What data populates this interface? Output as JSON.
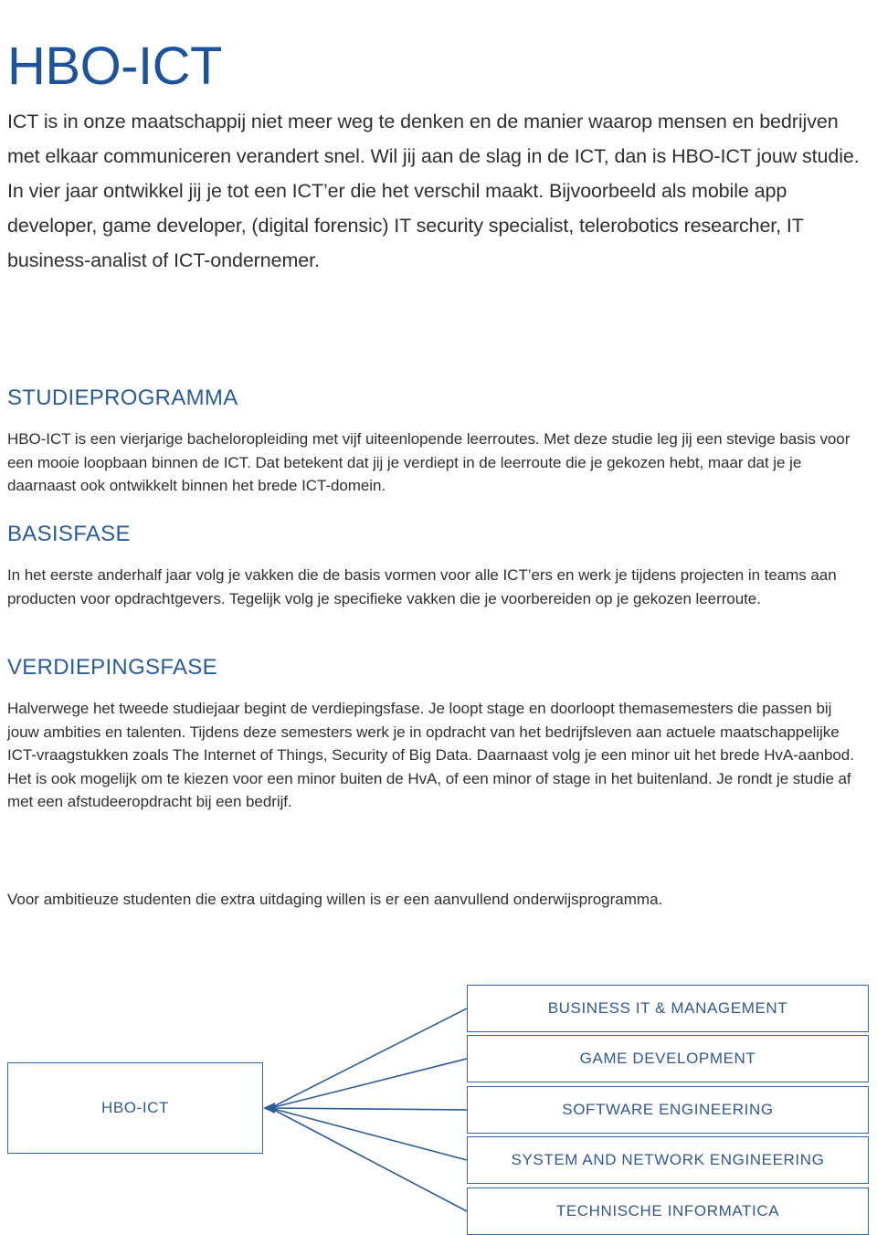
{
  "document": {
    "title": "HBO-ICT",
    "intro": "ICT is in onze maatschappij niet meer weg te denken en de manier waarop mensen en bedrijven met elkaar communiceren verandert snel. Wil jij aan de slag in de ICT, dan is HBO-ICT jouw studie. In vier jaar ontwikkel jij je tot een ICT’er die het verschil maakt. Bijvoorbeeld als mobile app developer, game developer, (digital forensic) IT security specialist, telerobotics researcher, IT business-analist of ICT-ondernemer.",
    "closing_note": "Voor ambitieuze studenten die extra uitdaging willen is er een aanvullend onderwijsprogramma."
  },
  "sections": [
    {
      "heading": "STUDIEPROGRAMMA",
      "body": "HBO-ICT is een vierjarige bacheloropleiding met vijf uiteenlopende leerroutes. Met deze studie leg jij een stevige basis voor een mooie loopbaan binnen de ICT. Dat betekent dat jij je verdiept in de leerroute die je gekozen hebt, maar dat je je daarnaast ook ontwikkelt binnen het brede ICT-domein."
    },
    {
      "heading": "BASISFASE",
      "body": "In het eerste anderhalf jaar volg je vakken die  de basis vormen voor alle ICT’ers en werk je tijdens projecten in teams aan producten voor opdrachtgevers. Tegelijk volg je specifieke vakken die je voorbereiden op je gekozen leerroute."
    },
    {
      "heading": "VERDIEPINGSFASE",
      "body": "Halverwege het tweede studiejaar begint de verdiepingsfase. Je loopt stage en doorloopt themasemesters die passen bij jouw ambities  en talenten. Tijdens deze semesters werk je in opdracht van het bedrijfsleven aan actuele maatschappelijke ICT-vraagstukken zoals The Internet of Things, Security of Big Data. Daarnaast volg je een minor uit het brede HvA-aanbod. Het is ook mogelijk om te kiezen voor een minor buiten de HvA, of een minor of stage in het buitenland. Je rondt je studie af met een afstudeeropdracht bij een bedrijf."
    }
  ],
  "diagram": {
    "root_label": "HBO-ICT",
    "leaves": [
      {
        "label": "BUSINESS IT & MANAGEMENT"
      },
      {
        "label": "GAME DEVELOPMENT"
      },
      {
        "label": "SOFTWARE ENGINEERING"
      },
      {
        "label": "SYSTEM AND NETWORK ENGINEERING"
      },
      {
        "label": "TECHNISCHE INFORMATICA"
      }
    ],
    "line_color": "#2f5c94",
    "box_border_color": "#36659e",
    "box_text_color": "#33598a"
  },
  "colors": {
    "title_blue": "#1f5399",
    "heading_blue": "#2a5c96",
    "body_text": "#2f2f2f"
  }
}
